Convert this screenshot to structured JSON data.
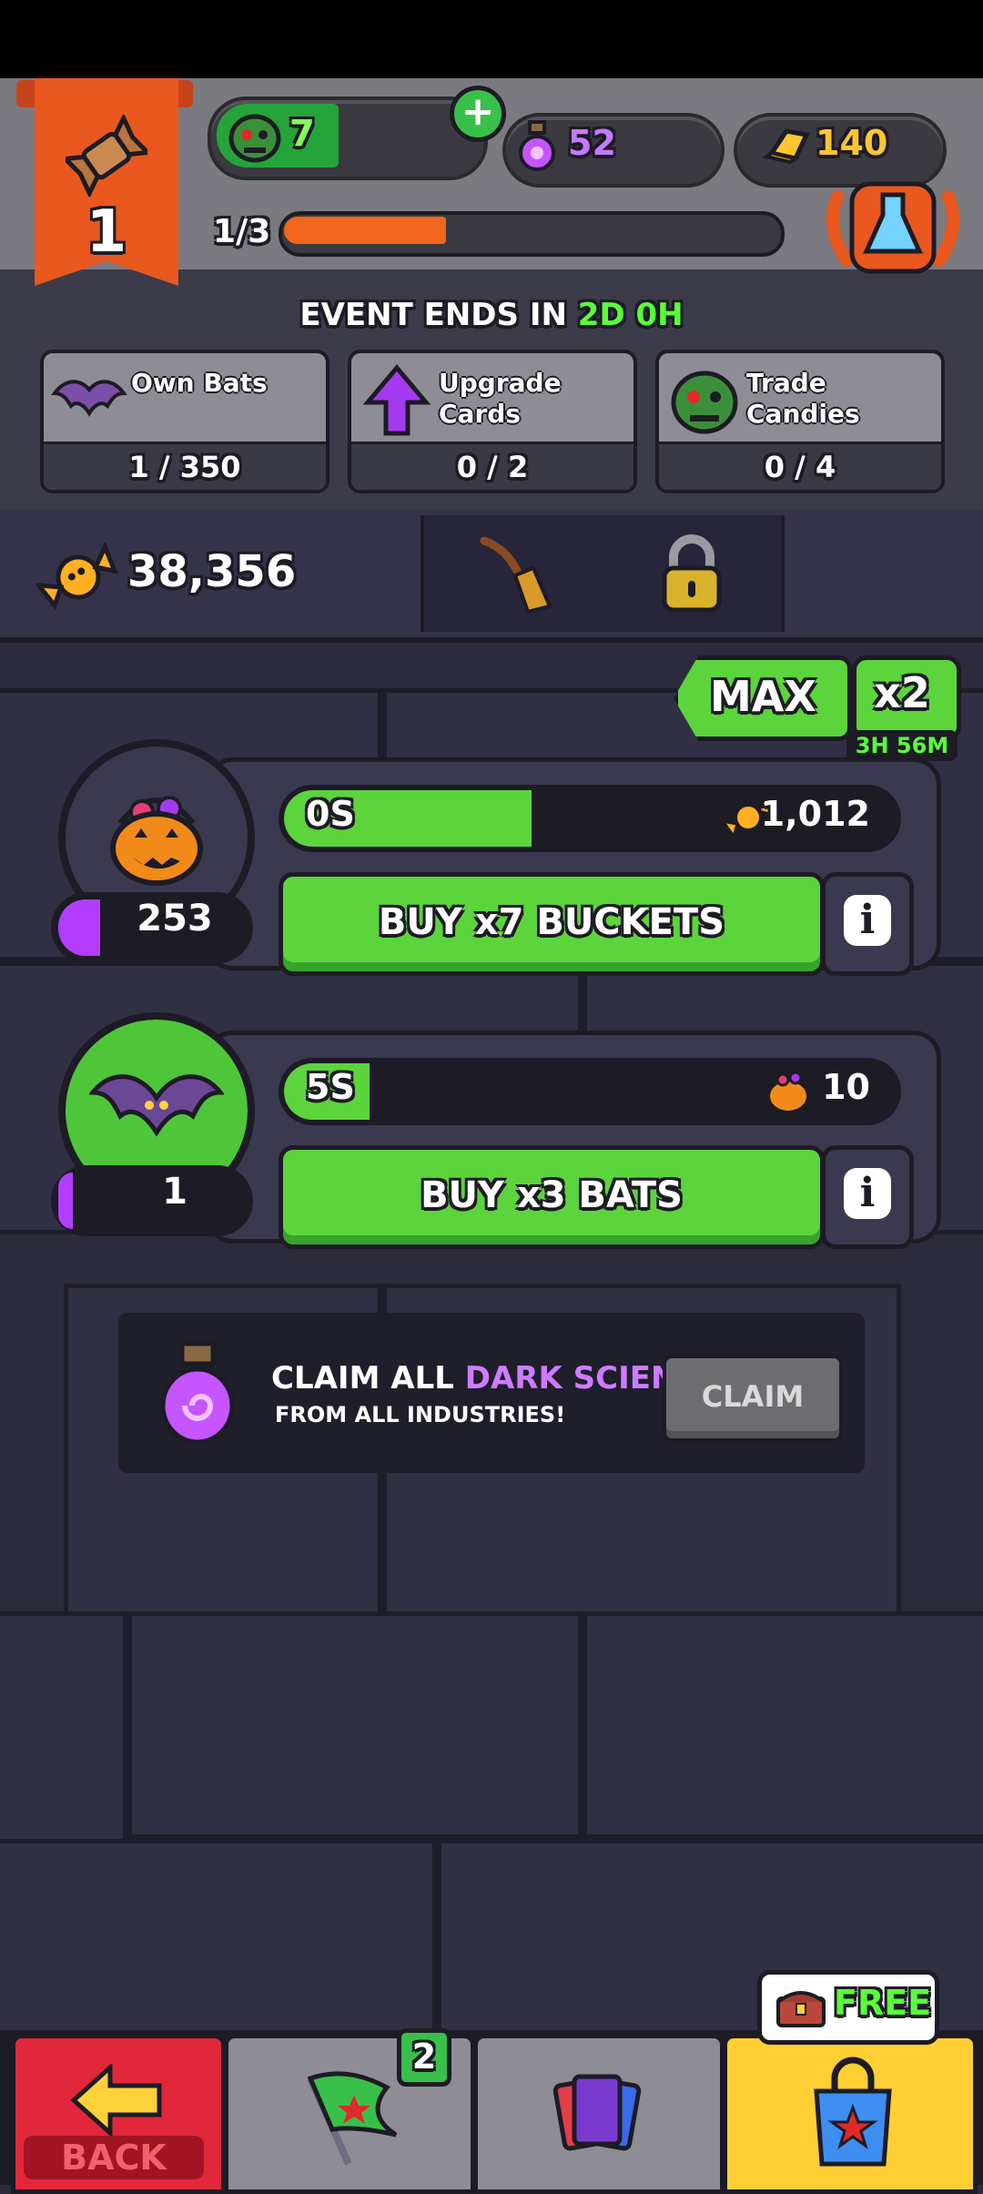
{
  "header": {
    "level": "1",
    "zombie_count": "7",
    "potion_count": "52",
    "gold_count": "140",
    "progress_text": "1/3",
    "progress_fraction": 0.33
  },
  "event": {
    "prefix": "EVENT ENDS IN ",
    "time": "2D 0H"
  },
  "tasks": [
    {
      "label": "Own Bats",
      "progress": "1 / 350"
    },
    {
      "label": "Upgrade Cards",
      "progress": "0 / 2"
    },
    {
      "label": "Trade Candies",
      "progress": "0 / 4"
    }
  ],
  "currency": {
    "candy_total": "38,356"
  },
  "boost": {
    "max_label": "MAX",
    "multiplier": "x2",
    "timer": "3H 56M"
  },
  "industries": [
    {
      "name": "buckets",
      "owned": "253",
      "timer": "0S",
      "timer_fill": 0.38,
      "reward": "1,012",
      "buy_label": "BUY x7 BUCKETS"
    },
    {
      "name": "bats",
      "owned": "1",
      "timer": "5S",
      "timer_fill": 0.1,
      "reward": "10",
      "buy_label": "BUY x3 BATS"
    }
  ],
  "claim": {
    "line1_prefix": "CLAIM ALL ",
    "line1_highlight": "DARK SCIENCE",
    "line2": "FROM ALL INDUSTRIES!",
    "button": "CLAIM"
  },
  "nav": {
    "back_label": "BACK",
    "flag_badge": "2",
    "free_label": "FREE"
  },
  "colors": {
    "accent_green": "#5cd43c",
    "accent_orange": "#f0661c",
    "accent_purple": "#b23dff",
    "back_red": "#e0283a",
    "shop_yellow": "#ffcf33"
  }
}
